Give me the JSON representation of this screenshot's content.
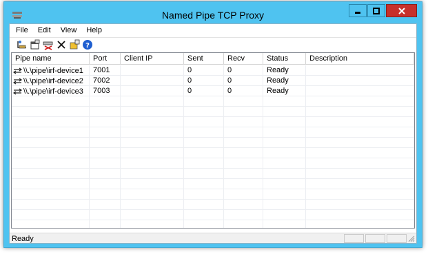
{
  "window": {
    "title": "Named Pipe TCP Proxy"
  },
  "menu": [
    "File",
    "Edit",
    "View",
    "Help"
  ],
  "toolbar": {
    "buttons": [
      "add-pipe-icon",
      "properties-icon",
      "disconnect-icon",
      "delete-icon",
      "settings-icon",
      "help-icon"
    ]
  },
  "list": {
    "columns": [
      "Pipe name",
      "Port",
      "Client IP",
      "Sent",
      "Recv",
      "Status",
      "Description"
    ],
    "rows": [
      {
        "pipe": "\\\\.\\pipe\\irf-device1",
        "port": "7001",
        "client_ip": "",
        "sent": "0",
        "recv": "0",
        "status": "Ready",
        "description": ""
      },
      {
        "pipe": "\\\\.\\pipe\\irf-device2",
        "port": "7002",
        "client_ip": "",
        "sent": "0",
        "recv": "0",
        "status": "Ready",
        "description": ""
      },
      {
        "pipe": "\\\\.\\pipe\\irf-device3",
        "port": "7003",
        "client_ip": "",
        "sent": "0",
        "recv": "0",
        "status": "Ready",
        "description": ""
      }
    ]
  },
  "statusbar": {
    "text": "Ready"
  },
  "colors": {
    "titlebar": "#4fc3f0",
    "close_button": "#c7302b"
  }
}
